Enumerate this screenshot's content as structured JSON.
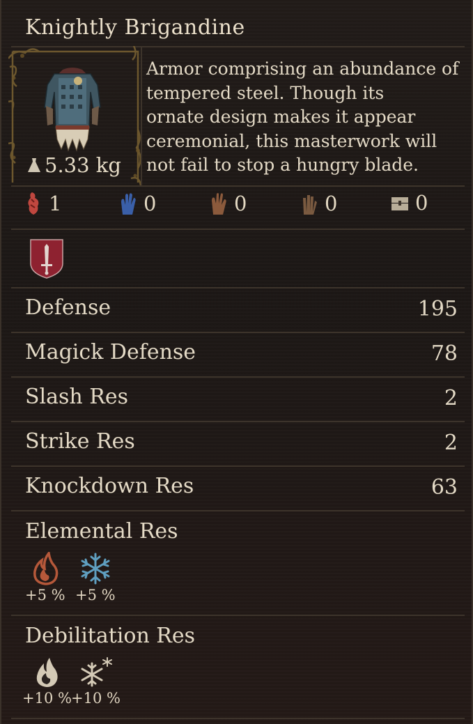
{
  "item": {
    "name": "Knightly Brigandine",
    "weight": "5.33 kg",
    "description_lines": [
      "Armor comprising an abundance of",
      "tempered steel. Though its",
      "ornate design makes it appear",
      "ceremonial, this masterwork will",
      "not fail to stop a hungry blade."
    ]
  },
  "upgrades": [
    {
      "icon": "red-claw-icon",
      "value": "1"
    },
    {
      "icon": "blue-hand-icon",
      "value": "0"
    },
    {
      "icon": "bronze-claw-icon",
      "value": "0"
    },
    {
      "icon": "stone-claw-icon",
      "value": "0"
    },
    {
      "icon": "chest-icon",
      "value": "0"
    }
  ],
  "vocation_badge": "sword-shield-icon",
  "stats": [
    {
      "label": "Defense",
      "value": "195"
    },
    {
      "label": "Magick Defense",
      "value": "78"
    },
    {
      "label": "Slash Res",
      "value": "2"
    },
    {
      "label": "Strike Res",
      "value": "2"
    },
    {
      "label": "Knockdown Res",
      "value": "63"
    }
  ],
  "elemental": {
    "title": "Elemental Res",
    "items": [
      {
        "icon": "fire-icon",
        "value": "+5 %"
      },
      {
        "icon": "ice-icon",
        "value": "+5 %"
      }
    ]
  },
  "debilitation": {
    "title": "Debilitation Res",
    "items": [
      {
        "icon": "burning-icon",
        "value": "+10 %"
      },
      {
        "icon": "frozen-icon",
        "value": "+10 %"
      }
    ]
  },
  "colors": {
    "text": "#e4dac6",
    "divider": "#3d342b",
    "red_claw": "#c0473f",
    "blue_hand": "#3a5fa8",
    "bronze": "#8b5a3c",
    "fire": "#b5583a",
    "ice": "#5f9fc0",
    "badge": "#8e2230"
  }
}
